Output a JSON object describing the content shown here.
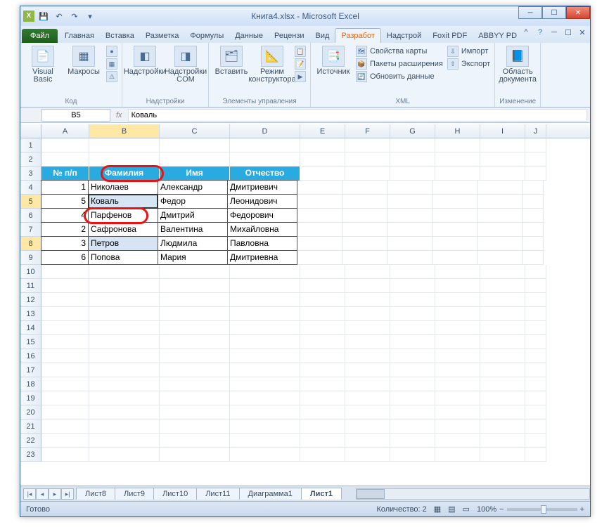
{
  "title": "Книга4.xlsx - Microsoft Excel",
  "tabs": {
    "file": "Файл",
    "home": "Главная",
    "insert": "Вставка",
    "layout": "Разметка",
    "formulas": "Формулы",
    "data": "Данные",
    "review": "Рецензи",
    "view": "Вид",
    "developer": "Разработ",
    "addins": "Надстрой",
    "foxit": "Foxit PDF",
    "abbyy": "ABBYY PD"
  },
  "ribbon": {
    "code": {
      "vb": "Visual\nBasic",
      "macros": "Макросы",
      "label": "Код"
    },
    "addins": {
      "a1": "Надстройки",
      "a2": "Надстройки\nCOM",
      "label": "Надстройки"
    },
    "ctrl": {
      "insert": "Вставить",
      "design": "Режим\nконструктора",
      "label": "Элементы управления"
    },
    "xml": {
      "src": "Источник",
      "p1": "Свойства карты",
      "p2": "Пакеты расширения",
      "p3": "Обновить данные",
      "imp": "Импорт",
      "exp": "Экспорт",
      "label": "XML"
    },
    "doc": {
      "panel": "Область\nдокумента",
      "label": "Изменение"
    }
  },
  "fbar": {
    "name": "B5",
    "value": "Коваль"
  },
  "headers": {
    "A": "№ п/п",
    "B": "Фамилия",
    "C": "Имя",
    "D": "Отчество"
  },
  "data": [
    {
      "n": "1",
      "f": "Николаев",
      "i": "Александр",
      "o": "Дмитриевич"
    },
    {
      "n": "5",
      "f": "Коваль",
      "i": "Федор",
      "o": "Леонидович"
    },
    {
      "n": "4",
      "f": "Парфенов",
      "i": "Дмитрий",
      "o": "Федорович"
    },
    {
      "n": "2",
      "f": "Сафронова",
      "i": "Валентина",
      "o": "Михайловна"
    },
    {
      "n": "3",
      "f": "Петров",
      "i": "Людмила",
      "o": "Павловна"
    },
    {
      "n": "6",
      "f": "Попова",
      "i": "Мария",
      "o": "Дмитриевна"
    }
  ],
  "sheets": {
    "s": [
      "Лист8",
      "Лист9",
      "Лист10",
      "Лист11",
      "Диаграмма1",
      "Лист1"
    ]
  },
  "status": {
    "ready": "Готово",
    "count": "Количество: 2",
    "zoom": "100%"
  }
}
